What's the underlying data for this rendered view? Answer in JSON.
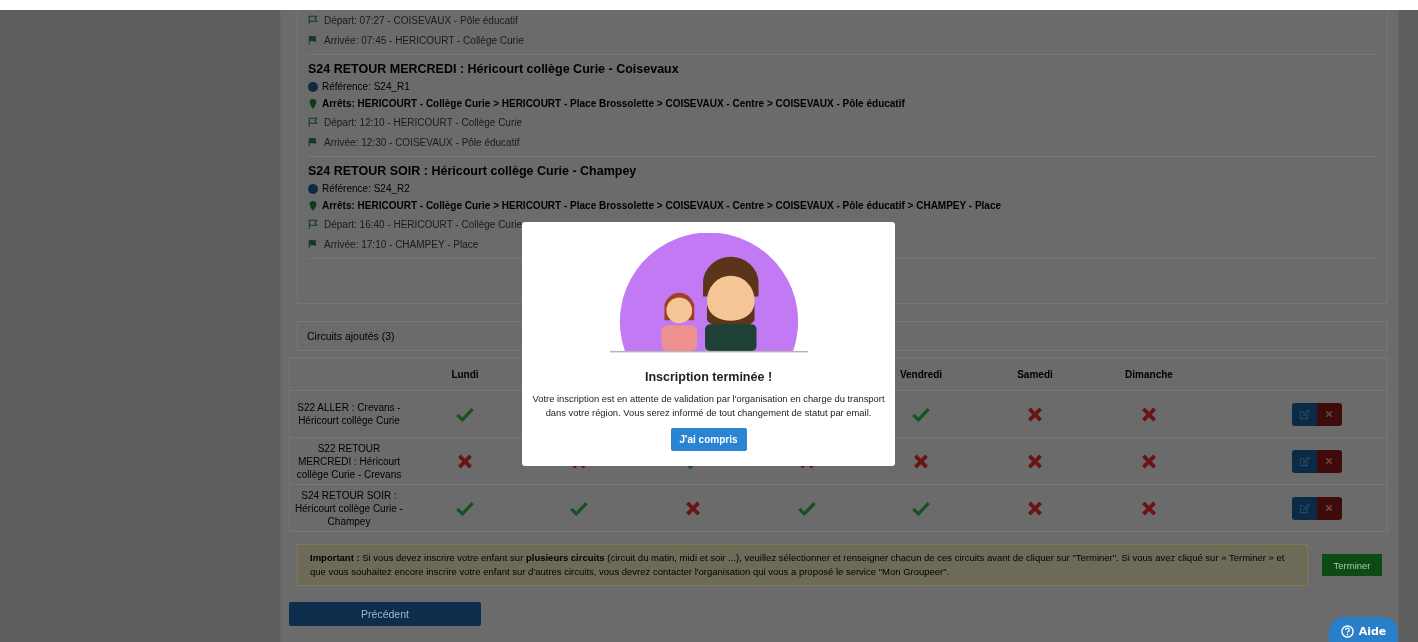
{
  "circuits": [
    {
      "departure": "Départ: 07:27 - COISEVAUX - Pôle éducatif",
      "arrival": "Arrivée: 07:45 - HERICOURT - Collège Curie"
    },
    {
      "title": "S24 RETOUR MERCREDI : Héricourt collège Curie - Coisevaux",
      "reference": "Référence: S24_R1",
      "stops": "Arrêts: HERICOURT - Collège Curie > HERICOURT - Place Brossolette > COISEVAUX - Centre > COISEVAUX - Pôle éducatif",
      "departure": "Départ: 12:10 - HERICOURT - Collège Curie",
      "arrival": "Arrivée: 12:30 - COISEVAUX - Pôle éducatif"
    },
    {
      "title": "S24 RETOUR SOIR : Héricourt collège Curie - Champey",
      "reference": "Référence: S24_R2",
      "stops": "Arrêts: HERICOURT - Collège Curie > HERICOURT - Place Brossolette > COISEVAUX - Centre > COISEVAUX - Pôle éducatif > CHAMPEY - Place",
      "departure": "Départ: 16:40 - HERICOURT - Collège Curie",
      "arrival": "Arrivée: 17:10 - CHAMPEY - Place"
    }
  ],
  "added": {
    "title": "Circuits ajoutés (3)",
    "columns": [
      {
        "label": "Lundi"
      },
      {},
      {},
      {},
      {
        "label": "Vendredi"
      },
      {
        "label": "Samedi"
      },
      {
        "label": "Dimanche"
      }
    ],
    "rows": [
      {
        "name": "S22 ALLER : Crevans - Héricourt collège Curie",
        "days": [
          {
            "kind": "check"
          },
          {
            "kind": "covered"
          },
          {
            "kind": "covered"
          },
          {
            "kind": "covered"
          },
          {
            "kind": "check"
          },
          {
            "kind": "cross"
          },
          {
            "kind": "cross"
          }
        ]
      },
      {
        "name": "S22 RETOUR MERCREDI : Héricourt collège Curie - Crevans",
        "days": [
          {
            "kind": "cross"
          },
          {
            "kind": "cross"
          },
          {
            "kind": "check"
          },
          {
            "kind": "cross"
          },
          {
            "kind": "cross"
          },
          {
            "kind": "cross"
          },
          {
            "kind": "cross"
          }
        ]
      },
      {
        "name": "S24 RETOUR SOIR : Héricourt collège Curie - Champey",
        "days": [
          {
            "kind": "check"
          },
          {
            "kind": "check"
          },
          {
            "kind": "cross"
          },
          {
            "kind": "check"
          },
          {
            "kind": "check"
          },
          {
            "kind": "cross"
          },
          {
            "kind": "cross"
          }
        ]
      }
    ]
  },
  "notice": "**Important :** Si vous devez inscrire votre enfant sur **plusieurs circuits** (circuit du matin, midi et soir ...), veuillez sélectionner et renseigner chacun de ces circuits avant de cliquer sur \"Terminer\". Si vous avez cliqué sur « Terminer » et que vous souhaitez encore inscrire votre enfant sur d'autres circuits, vous devrez contacter l'organisation qui vous a proposé le service \"Mon Groupeer\".",
  "finish_button": "Terminer",
  "previous_button": "Précédent",
  "help_button": "Aide",
  "modal": {
    "title": "Inscription terminée !",
    "message": "Votre inscription est en attente de validation par l'organisation en charge du transport dans votre région. Vous serez informé de tout changement de statut par email.",
    "button": "J'ai compris"
  }
}
